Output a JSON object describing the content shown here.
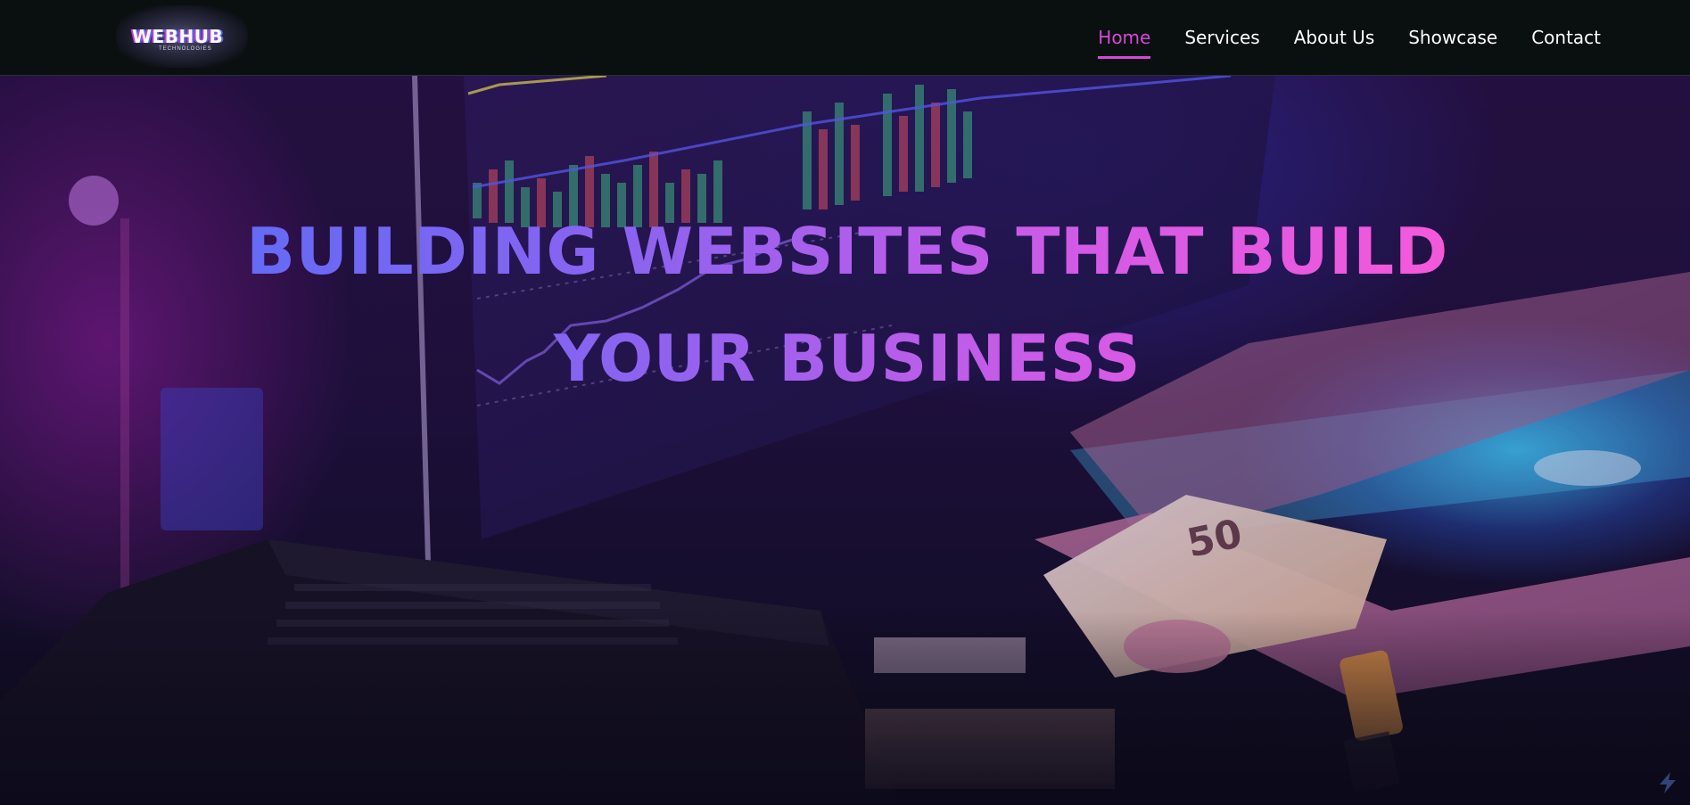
{
  "brand": {
    "logo_text": "WEBHUB",
    "logo_subtitle": "TECHNOLOGIES",
    "accent_color": "#d648d6"
  },
  "nav": {
    "items": [
      {
        "label": "Home",
        "active": true
      },
      {
        "label": "Services",
        "active": false
      },
      {
        "label": "About Us",
        "active": false
      },
      {
        "label": "Showcase",
        "active": false
      },
      {
        "label": "Contact",
        "active": false
      }
    ]
  },
  "hero": {
    "headline": "BUILDING WEBSITES THAT BUILD YOUR BUSINESS",
    "gradient_colors": [
      "#5a6cf7",
      "#8c63f0",
      "#d55ae6",
      "#ff58d6"
    ],
    "background_image": "hands-counting-cash-in-front-of-trading-chart-monitor"
  }
}
